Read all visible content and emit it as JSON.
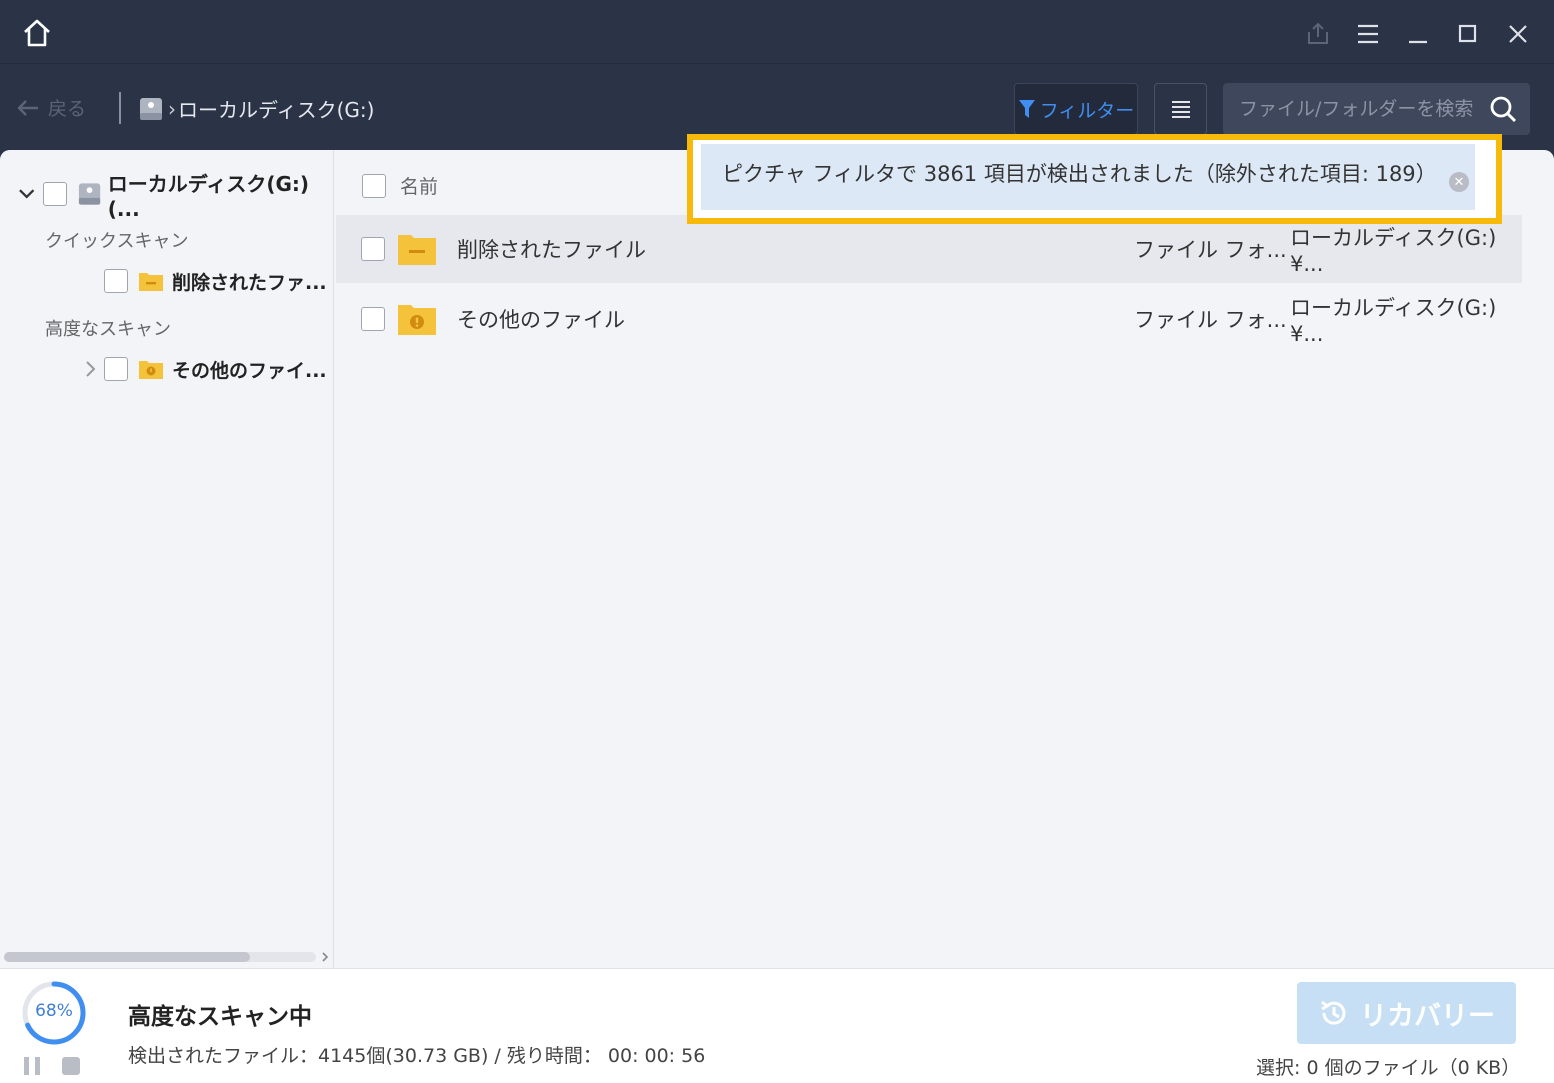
{
  "window": {
    "home_icon": "home-icon",
    "controls": [
      "share-icon",
      "menu-icon",
      "minimize-icon",
      "maximize-icon",
      "close-icon"
    ]
  },
  "toolbar": {
    "back_label": "戻る",
    "breadcrumb": "ローカルディスク(G:)",
    "filter_label": "フィルター",
    "search_placeholder": "ファイル/フォルダーを検索"
  },
  "sidebar": {
    "root_label": "ローカルディスク(G:)(...",
    "quick_scan_label": "クイックスキャン",
    "deleted_label": "削除されたファ...",
    "advanced_scan_label": "高度なスキャン",
    "other_label": "その他のファイ..."
  },
  "table": {
    "header_name": "名前",
    "rows": [
      {
        "name": "削除されたファイル",
        "type": "ファイル フォ...",
        "path": "ローカルディスク(G:)¥..."
      },
      {
        "name": "その他のファイル",
        "type": "ファイル フォ...",
        "path": "ローカルディスク(G:)¥..."
      }
    ]
  },
  "notification": {
    "text": "ピクチャ フィルタで 3861 項目が検出されました（除外された項目: 189）"
  },
  "footer": {
    "progress_percent": 68,
    "progress_label": "68%",
    "scan_title": "高度なスキャン中",
    "scan_info": "検出されたファイル：4145個(30.73 GB) / 残り時間： 00: 00: 56",
    "recover_label": "リカバリー",
    "selection_text": "選択: 0 個のファイル（0 KB）"
  },
  "colors": {
    "titlebar": "#2b3347",
    "accent": "#3f8ef0",
    "highlight_border": "#f7b90a",
    "folder": "#f5c33b",
    "recover_disabled": "#c6dff4"
  }
}
